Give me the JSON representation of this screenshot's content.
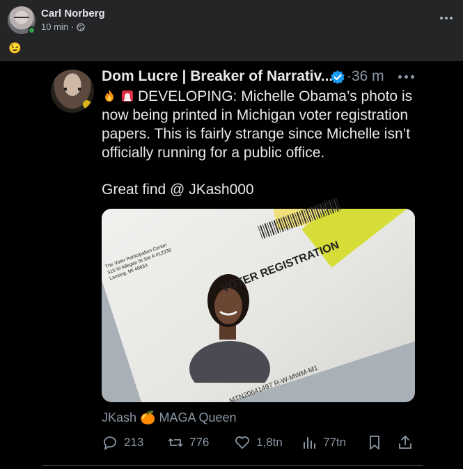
{
  "post": {
    "author": "Carl Norberg",
    "time": "10 min",
    "separator": "·",
    "caption_emoji": "😉"
  },
  "tweet": {
    "author": "Dom Lucre | Breaker of Narrativ...",
    "time": "·36 m",
    "text_lines": [
      "DEVELOPING: Michelle Obama’s photo is",
      "now being printed in Michigan voter registration",
      "papers. This is fairly strange since Michelle isn’t",
      "officially running for a public office."
    ],
    "text_second": "Great find @ JKash000",
    "byline": "JKash 🍊 MAGA Queen",
    "stats": {
      "replies": "213",
      "reposts": "776",
      "likes": "1,8tn",
      "views": "77tn"
    },
    "photo": {
      "voter_registration": "VOTER REGISTRATION",
      "sender_lines": [
        "The Voter Participation Center",
        "315 W Allegan St Ste A #12338",
        "Lansing, MI 48933"
      ],
      "code": "MTN20641497  R-W-MWM-M1"
    }
  },
  "colors": {
    "background": "#242526",
    "screenshot_bg": "#000000",
    "verified": "#1d9bf0",
    "online": "#31a24c"
  }
}
